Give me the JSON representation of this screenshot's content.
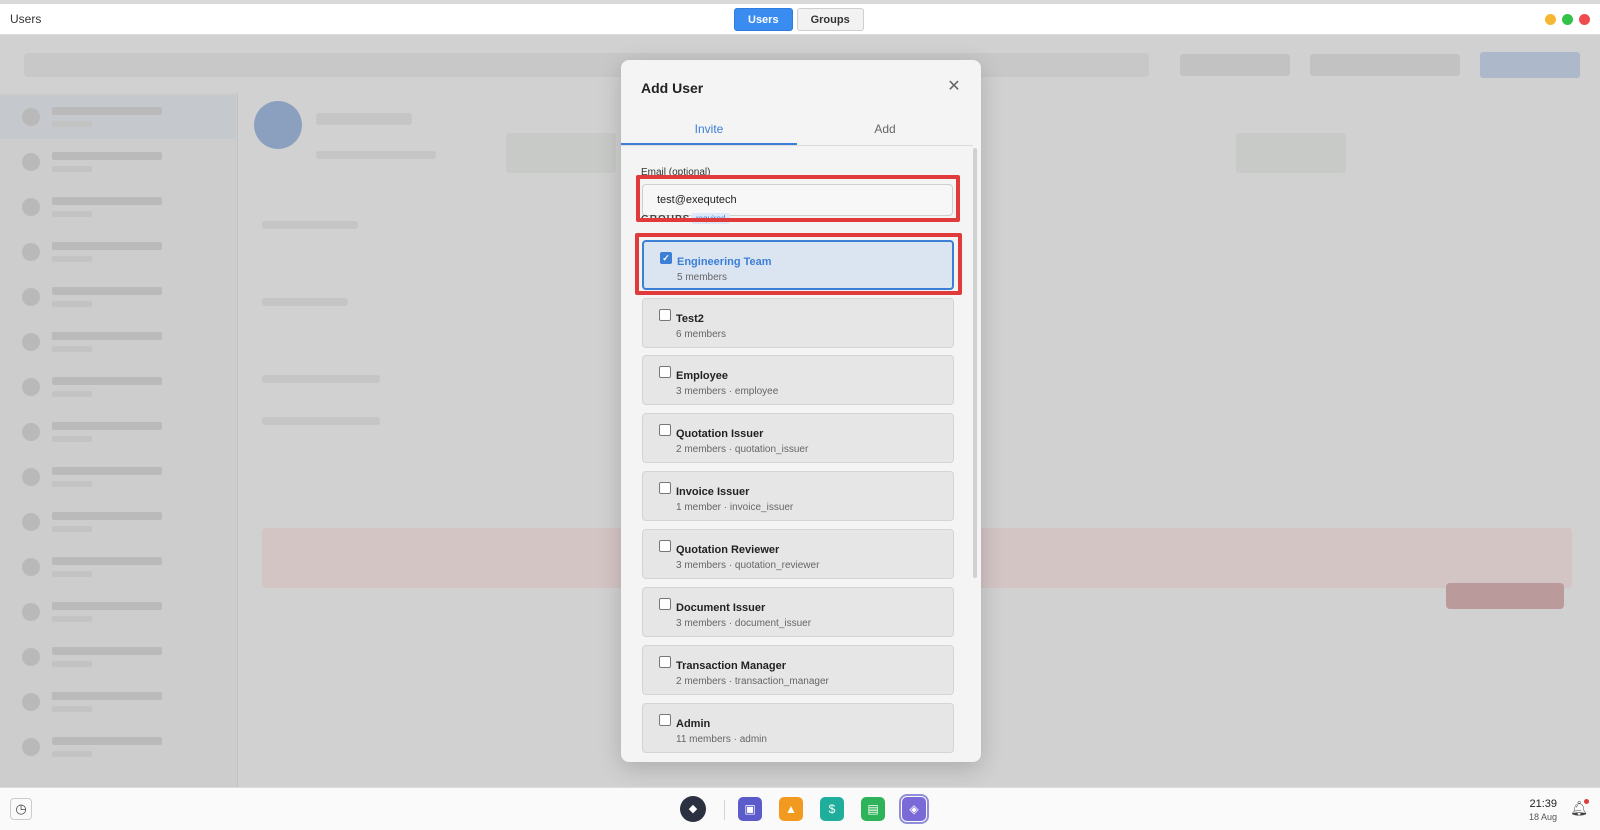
{
  "window": {
    "title": "Users",
    "tabs": [
      {
        "label": "Users",
        "active": true
      },
      {
        "label": "Groups",
        "active": false
      }
    ],
    "controls": {
      "minimize_color": "#f5b731",
      "maximize_color": "#35c24a",
      "close_color": "#ef4d4d"
    }
  },
  "modal": {
    "title": "Add User",
    "close_icon": "close-icon",
    "tabs": [
      {
        "label": "Invite",
        "active": true
      },
      {
        "label": "Add",
        "active": false
      }
    ],
    "email": {
      "label": "Email (optional)",
      "value": "test@exequtech"
    },
    "groups_label": "GROUPS",
    "required_label": "required",
    "groups": [
      {
        "name": "Engineering Team",
        "meta": "5 members",
        "checked": true
      },
      {
        "name": "Test2",
        "meta": "6 members",
        "checked": false
      },
      {
        "name": "Employee",
        "meta": "3 members · employee",
        "checked": false
      },
      {
        "name": "Quotation Issuer",
        "meta": "2 members · quotation_issuer",
        "checked": false
      },
      {
        "name": "Invoice Issuer",
        "meta": "1 member · invoice_issuer",
        "checked": false
      },
      {
        "name": "Quotation Reviewer",
        "meta": "3 members · quotation_reviewer",
        "checked": false
      },
      {
        "name": "Document Issuer",
        "meta": "3 members · document_issuer",
        "checked": false
      },
      {
        "name": "Transaction Manager",
        "meta": "2 members · transaction_manager",
        "checked": false
      },
      {
        "name": "Admin",
        "meta": "11 members · admin",
        "checked": false
      }
    ],
    "accent": "#3b7fd6",
    "highlight_color": "#e03a3a"
  },
  "taskbar": {
    "time": "21:39",
    "date": "18 Aug",
    "apps": [
      {
        "icon": "contacts-app-icon",
        "color": "#5b5bc9"
      },
      {
        "icon": "modules-app-icon",
        "color": "#f29a1f"
      },
      {
        "icon": "finance-app-icon",
        "color": "#1fae9c"
      },
      {
        "icon": "clipboard-app-icon",
        "color": "#2fb35a"
      },
      {
        "icon": "shield-app-icon",
        "color": "#7a6ad8"
      }
    ]
  }
}
